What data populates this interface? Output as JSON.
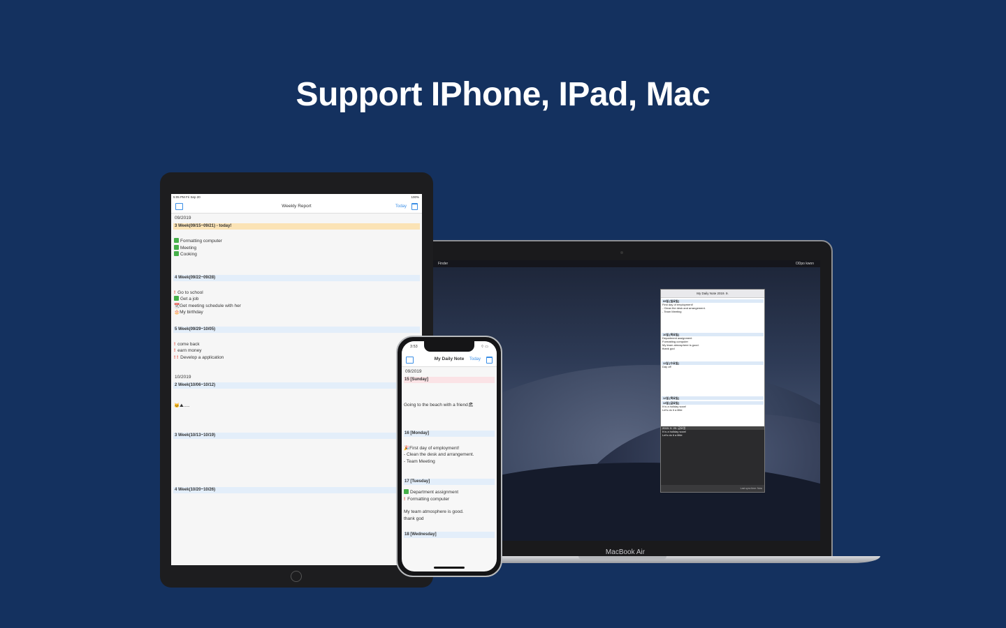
{
  "headline": "Support IPhone, IPad, Mac",
  "ipad": {
    "status_time": "5:05 PM   Fri Sep 20",
    "status_right": "100%",
    "nav_title": "Weekly Report",
    "nav_today": "Today",
    "months": [
      "09/2019",
      "10/2019"
    ],
    "weeks": [
      {
        "label": "3 Week(09/15~09/21) - today!",
        "items": [
          "Formatting computer",
          "Meeting",
          "Cooking"
        ]
      },
      {
        "label": "4 Week(09/22~09/28)",
        "items": [
          "Go to school",
          "Get a job",
          "Get meeting schedule with her",
          "My birthday"
        ]
      },
      {
        "label": "5 Week(09/29~10/05)",
        "items": [
          "come back",
          "earn money",
          "Develop a application"
        ]
      },
      {
        "label": "2 Week(10/06~10/12)",
        "items": [
          "....."
        ]
      },
      {
        "label": "3 Week(10/13~10/19)"
      },
      {
        "label": "4 Week(10/20~10/26)"
      }
    ]
  },
  "iphone": {
    "status_time": "3:53",
    "nav_title": "My Daily Note",
    "nav_today": "Today",
    "month": "09/2019",
    "days": [
      {
        "label": "15 [Sunday]",
        "items": [
          "Going to the beach with a friend"
        ]
      },
      {
        "label": "16 [Monday]",
        "items": [
          "First day of employment!",
          "- Clean the desk and arrangement.",
          "- Team Meeting"
        ]
      },
      {
        "label": "17 [Tuesday]",
        "items": [
          "Department assignment",
          "Formatting computer",
          "My team atmosphere is good.",
          "thank god"
        ]
      },
      {
        "label": "18 [Wednesday]"
      }
    ]
  },
  "mac": {
    "label": "MacBook Air",
    "menubar_app": "Finder",
    "menubar_right": "ODpo kwon",
    "app_title": "My Daily Note",
    "app_subtitle": "2019. 9.",
    "entries": [
      {
        "label": "09일 [일요일]",
        "items": [
          "First day of employment!",
          "- Clean the desk and arrangement.",
          "- Team Meeting"
        ]
      },
      {
        "label": "10일 [목요일]",
        "items": [
          "Department assignment",
          "Formatting computer",
          "My team atmosphere is good.",
          "thank god"
        ]
      },
      {
        "label": "11일 [수요일]",
        "items": [
          "Day off"
        ]
      },
      {
        "label": "12일 [목요일]"
      },
      {
        "label": "13일 [금요일]",
        "items": [
          "It is a holiday soon!",
          "Let's do it a little"
        ]
      }
    ],
    "dark_header": "2019. 9. 20. 금요일",
    "dark_items": [
      "It is a holiday soon!",
      "Let's do it a little"
    ],
    "footer": "Last sync time: Now"
  }
}
